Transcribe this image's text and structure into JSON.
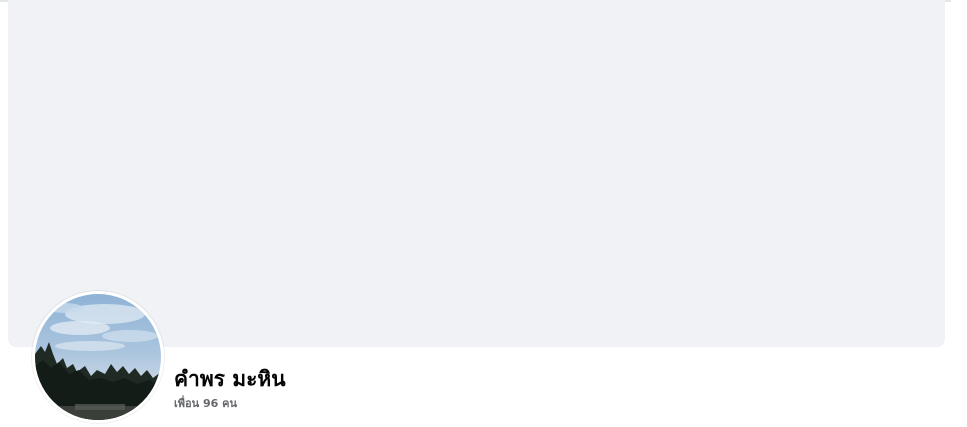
{
  "profile": {
    "name": "คำพร มะหิน",
    "friends_text": "เพื่อน 96 คน"
  },
  "colors": {
    "cover_background": "#f0f2f5",
    "name_text": "#050505",
    "secondary_text": "#65676b"
  }
}
